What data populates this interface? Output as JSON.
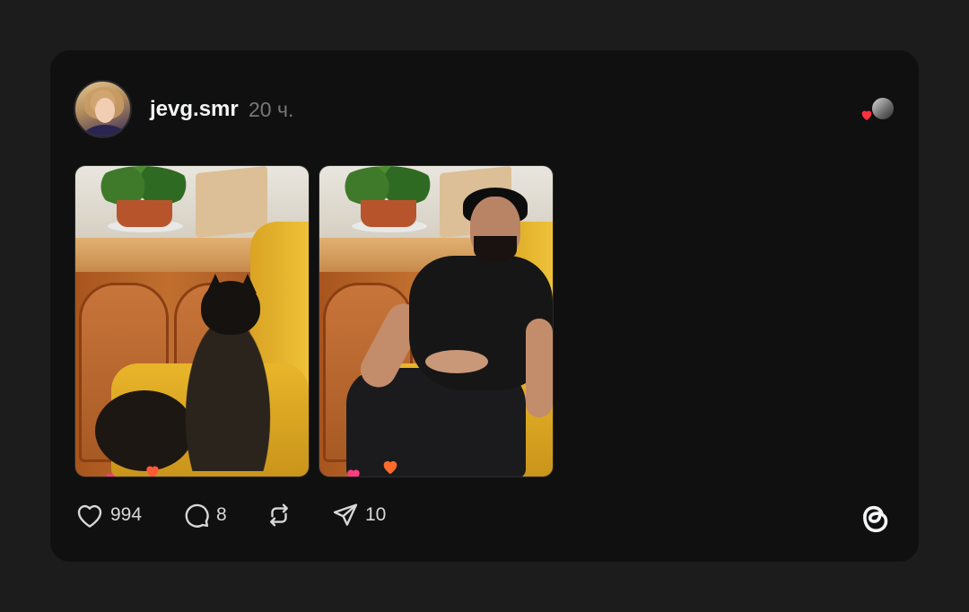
{
  "post": {
    "username": "jevg.smr",
    "timestamp": "20 ч.",
    "likes": "994",
    "comments": "8",
    "shares": "10"
  },
  "icons": {
    "like": "heart-icon",
    "comment": "comment-icon",
    "repost": "repost-icon",
    "share": "send-icon",
    "logo": "threads-logo-icon",
    "liked_badge": "heart-badge-icon"
  },
  "colors": {
    "page_background": "#1c1c1c",
    "card_background": "#101010",
    "primary_text": "#f3f5f7",
    "secondary_text": "#777777",
    "like_red": "#ff3040"
  }
}
